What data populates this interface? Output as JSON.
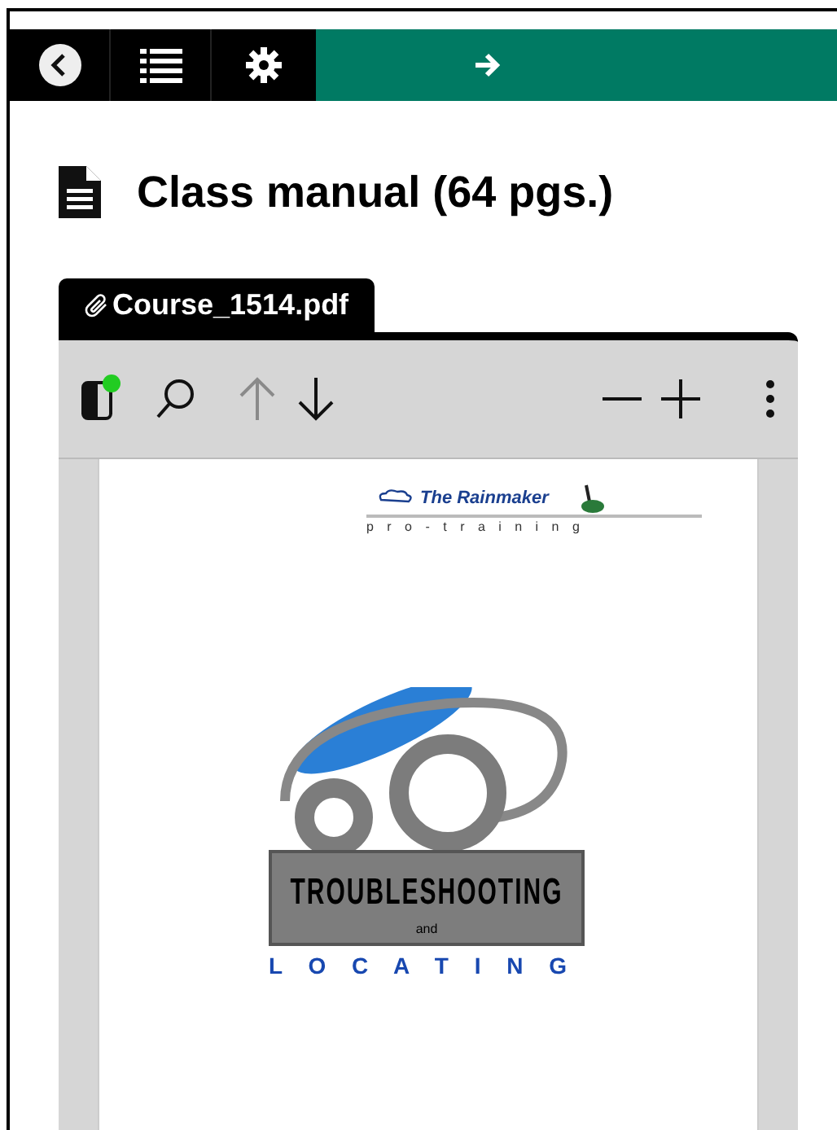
{
  "heading": {
    "title": "Class manual (64 pgs.)"
  },
  "attachment": {
    "filename": "Course_1514.pdf"
  },
  "viewer_toolbar": {
    "sidebar_badge": true,
    "previous_page_disabled": true,
    "next_page_disabled": false
  },
  "document_page": {
    "company_name": "The Rainmaker",
    "tagline": "p r o - t r a i n i n g",
    "logo_title": "TROUBLESHOOTING",
    "logo_conjunction": "and",
    "logo_subtitle": "L O C A T I N G"
  }
}
